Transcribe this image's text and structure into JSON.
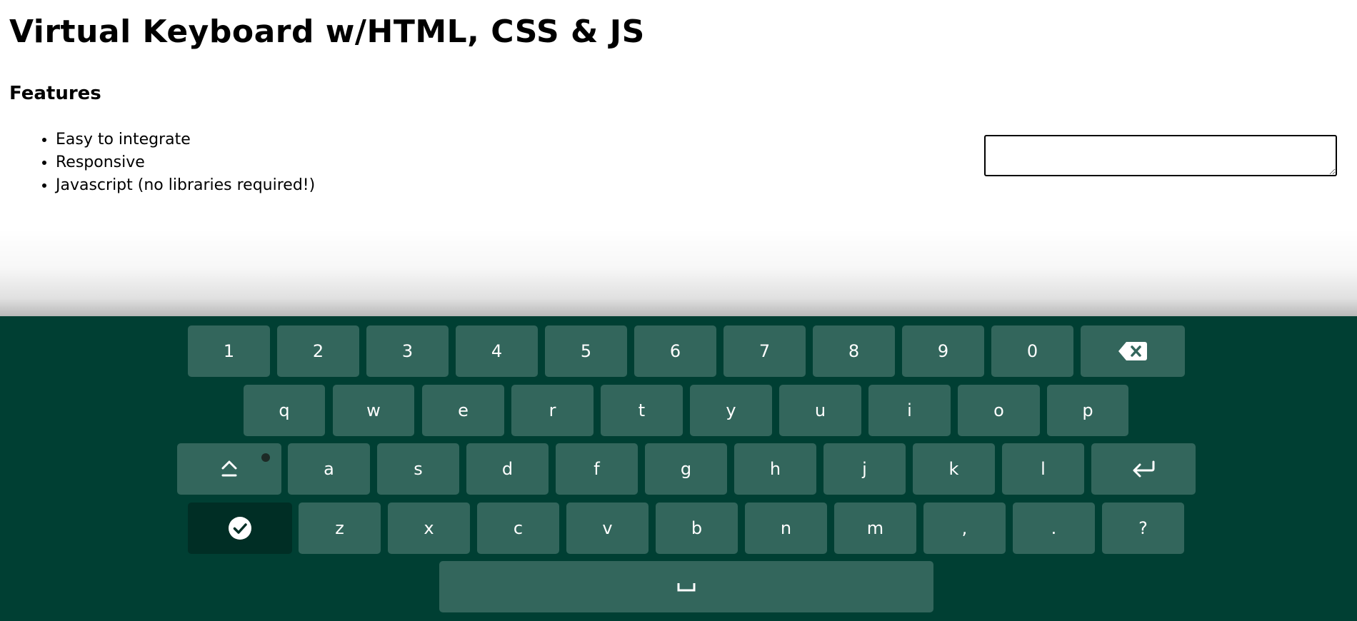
{
  "page": {
    "title": "Virtual Keyboard w/HTML, CSS & JS",
    "features_heading": "Features",
    "features": [
      "Easy to integrate",
      "Responsive",
      "Javascript (no libraries required!)"
    ]
  },
  "textarea": {
    "value": "",
    "placeholder": ""
  },
  "keyboard": {
    "background_color": "#003f33",
    "key_color": "#33665c",
    "done_key_color": "#002e25",
    "row1": [
      "1",
      "2",
      "3",
      "4",
      "5",
      "6",
      "7",
      "8",
      "9",
      "0"
    ],
    "row2": [
      "q",
      "w",
      "e",
      "r",
      "t",
      "y",
      "u",
      "i",
      "o",
      "p"
    ],
    "row3": [
      "a",
      "s",
      "d",
      "f",
      "g",
      "h",
      "j",
      "k",
      "l"
    ],
    "row4": [
      "z",
      "x",
      "c",
      "v",
      "b",
      "n",
      "m",
      ",",
      ".",
      "?"
    ],
    "icons": {
      "backspace": "backspace-icon",
      "caps_lock": "caps-lock-icon",
      "enter": "enter-icon",
      "done": "check-circle-icon",
      "space": "space-bar-icon"
    }
  }
}
